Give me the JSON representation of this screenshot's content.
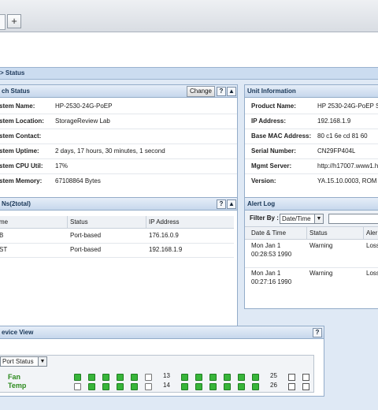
{
  "browser": {
    "new_tab_label": "+"
  },
  "breadcrumb": "> Status",
  "switch_status": {
    "title": "ch Status",
    "change_label": "Change",
    "help_label": "?",
    "collapse_label": "▲",
    "rows": [
      {
        "label": "stem Name:",
        "value": "HP-2530-24G-PoEP"
      },
      {
        "label": "stem Location:",
        "value": "StorageReview Lab"
      },
      {
        "label": "stem Contact:",
        "value": ""
      },
      {
        "label": "stem Uptime:",
        "value": "2 days, 17 hours, 30 minutes, 1 second"
      },
      {
        "label": "stem CPU Util:",
        "value": "17%"
      },
      {
        "label": "stem Memory:",
        "value": "67108864 Bytes"
      }
    ]
  },
  "unit_info": {
    "title": "Unit Information",
    "rows": [
      {
        "label": "Product Name:",
        "value": "HP 2530-24G-PoEP Swi"
      },
      {
        "label": "IP Address:",
        "value": "192.168.1.9"
      },
      {
        "label": "Base MAC Address:",
        "value": "80 c1 6e cd 81 60"
      },
      {
        "label": "Serial Number:",
        "value": "CN29FP404L"
      },
      {
        "label": "Mgmt Server:",
        "value": "http://h17007.www1.hp"
      },
      {
        "label": "Version:",
        "value": "YA.15.10.0003, ROM YA"
      }
    ]
  },
  "vlans": {
    "title": "Ns(2total)",
    "help_label": "?",
    "collapse_label": "▲",
    "columns": [
      "me",
      "Status",
      "IP Address"
    ],
    "rows": [
      [
        "B",
        "Port-based",
        "176.16.0.9"
      ],
      [
        "ST",
        "Port-based",
        "192.168.1.9"
      ]
    ]
  },
  "alert_log": {
    "title": "Alert Log",
    "filter_label": "Filter By :",
    "filter_value": "Date/Time",
    "columns": [
      "Date & Time",
      "Status",
      "Aler"
    ],
    "rows": [
      {
        "date": "Mon Jan 1",
        "time": "00:28:53 1990",
        "status": "Warning",
        "alert": "Loss"
      },
      {
        "date": "Mon Jan 1",
        "time": "00:27:16 1990",
        "status": "Warning",
        "alert": "Loss"
      }
    ]
  },
  "device_view": {
    "title": "evice View",
    "help_label": "?",
    "select_value": "Port Status",
    "fan_label": "Fan",
    "temp_label": "Temp",
    "port_labels": [
      "13",
      "14",
      "25",
      "26"
    ],
    "colors": {
      "port_up": "#38b53a",
      "label_green": "#2e8b1f"
    }
  }
}
